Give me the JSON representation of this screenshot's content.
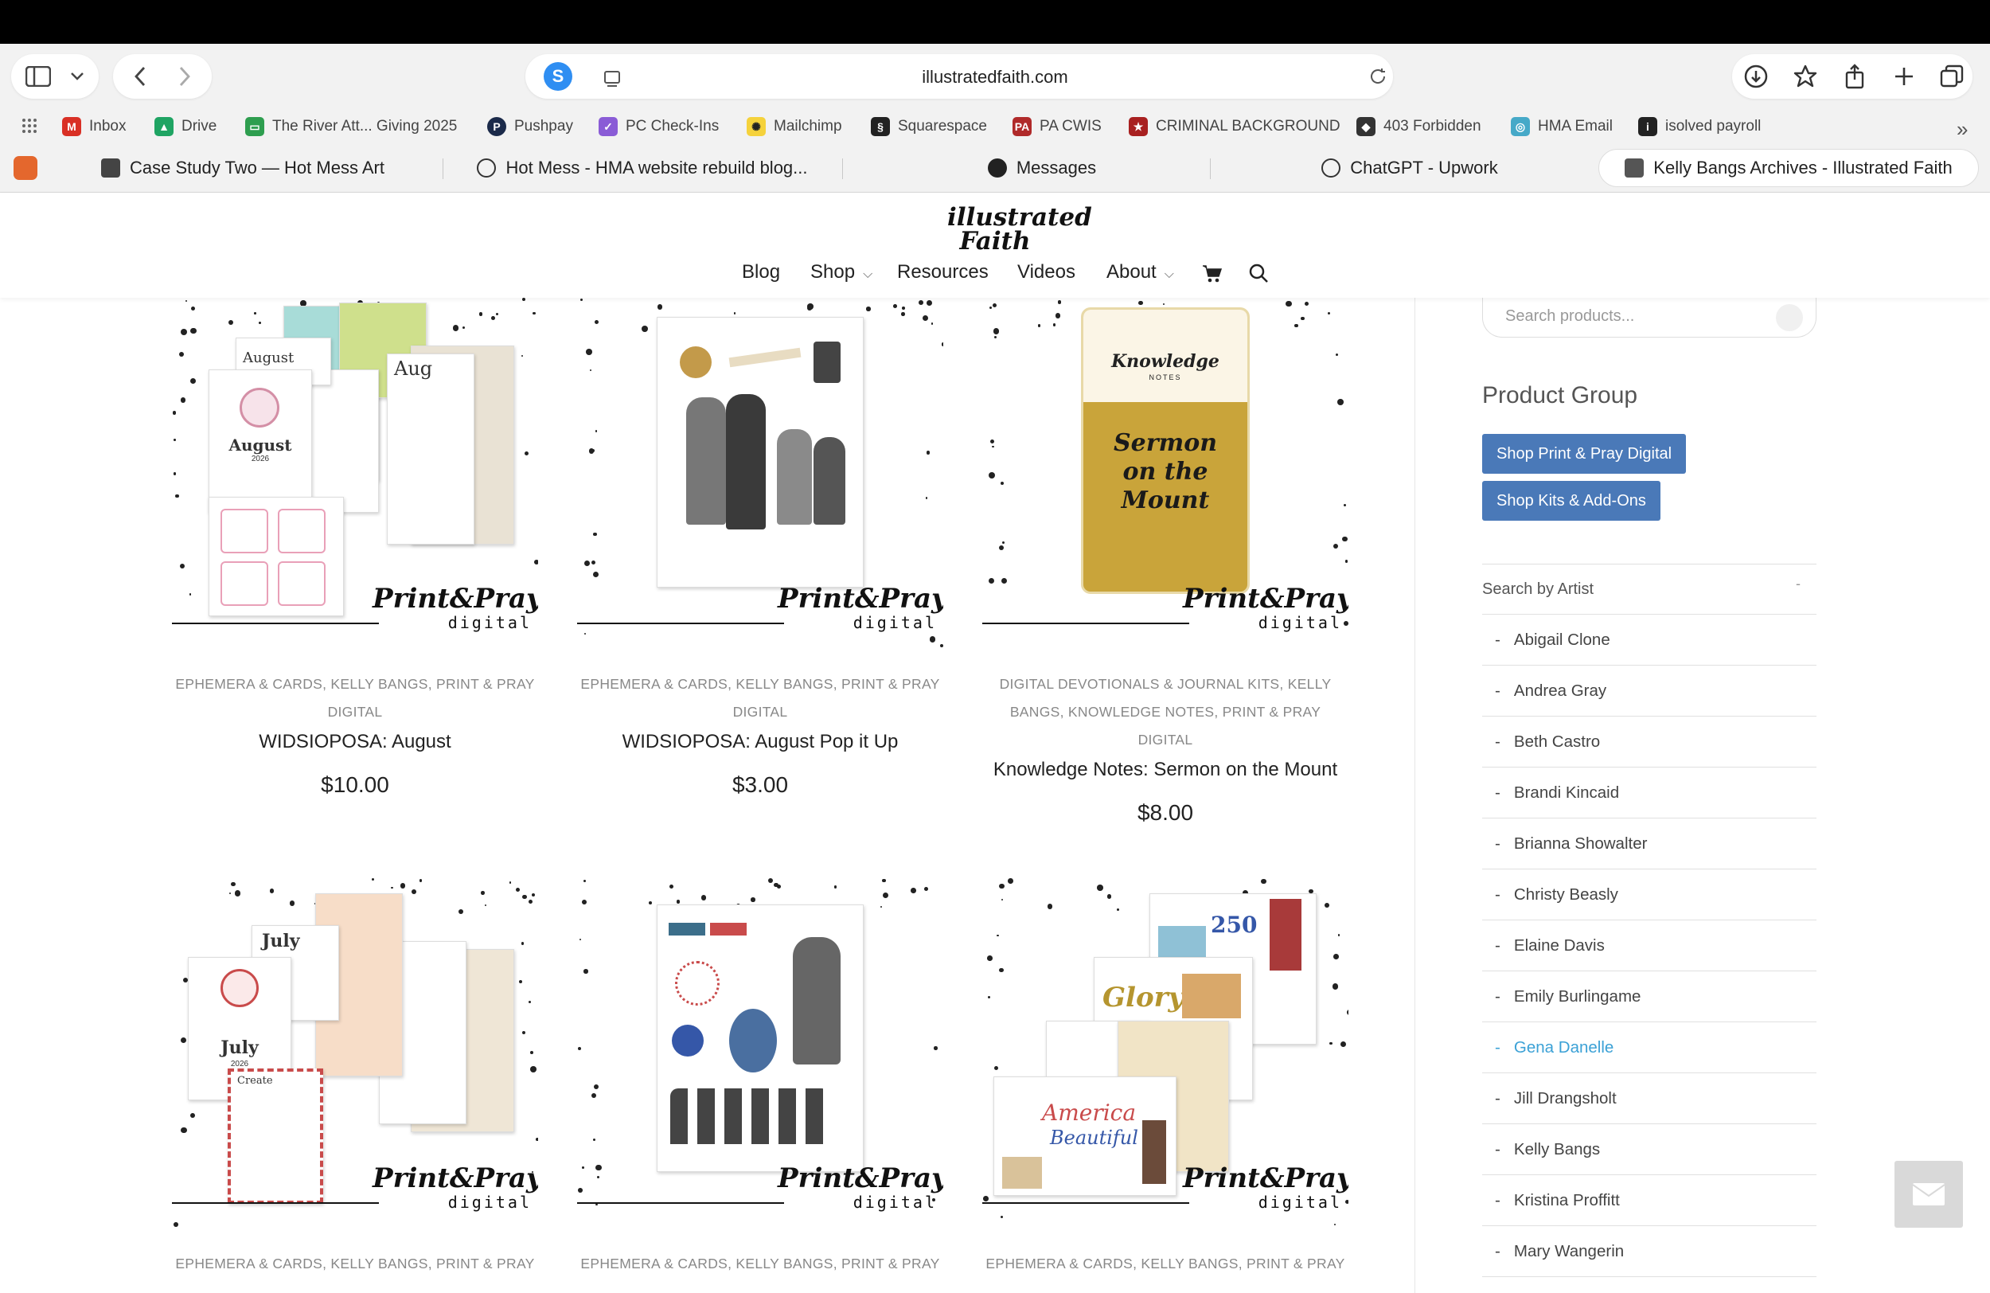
{
  "browser": {
    "url": "illustratedfaith.com",
    "bookmarks": [
      {
        "label": "Inbox",
        "icon": "gmail-icon",
        "color": "#d93025"
      },
      {
        "label": "Drive",
        "icon": "drive-icon",
        "color": "#1fa463"
      },
      {
        "label": "The River Att... Giving 2025",
        "icon": "giving-icon",
        "color": "#2e9e4f"
      },
      {
        "label": "Pushpay",
        "icon": "pushpay-icon",
        "color": "#1b2a4a"
      },
      {
        "label": "PC Check-Ins",
        "icon": "checkins-icon",
        "color": "#8a5cd6"
      },
      {
        "label": "Mailchimp",
        "icon": "mailchimp-icon",
        "color": "#f5d23c"
      },
      {
        "label": "Squarespace",
        "icon": "squarespace-icon",
        "color": "#222222"
      },
      {
        "label": "PA CWIS",
        "icon": "pa-icon",
        "color": "#b02a2a"
      },
      {
        "label": "CRIMINAL BACKGROUND",
        "icon": "badge-icon",
        "color": "#a82020"
      },
      {
        "label": "403 Forbidden",
        "icon": "cube-icon",
        "color": "#333333"
      },
      {
        "label": "HMA Email",
        "icon": "hma-icon",
        "color": "#46a9c8"
      },
      {
        "label": "isolved payroll",
        "icon": "isolved-icon",
        "color": "#222222"
      }
    ],
    "tabs": [
      {
        "label": "Case Study Two — Hot Mess Art",
        "icon": "cube-icon"
      },
      {
        "label": "Hot Mess - HMA website rebuild blog...",
        "icon": "openai-icon"
      },
      {
        "label": "Messages",
        "icon": "upwork-icon"
      },
      {
        "label": "ChatGPT - Upwork",
        "icon": "openai-icon"
      },
      {
        "label": "Kelly Bangs Archives - Illustrated Faith",
        "icon": "site-icon"
      }
    ]
  },
  "site": {
    "logo_text": "illustrated Faith",
    "nav": [
      {
        "label": "Blog"
      },
      {
        "label": "Shop"
      },
      {
        "label": "Resources"
      },
      {
        "label": "Videos"
      },
      {
        "label": "About"
      }
    ]
  },
  "products": [
    {
      "cats": [
        "EPHEMERA & CARDS, KELLY BANGS, PRINT & PRAY",
        "DIGITAL"
      ],
      "title": "WIDSIOPOSA: August",
      "price": "$10.00"
    },
    {
      "cats": [
        "EPHEMERA & CARDS, KELLY BANGS, PRINT & PRAY",
        "DIGITAL"
      ],
      "title": "WIDSIOPOSA: August Pop it Up",
      "price": "$3.00"
    },
    {
      "cats": [
        "DIGITAL DEVOTIONALS & JOURNAL KITS, KELLY",
        "BANGS, KNOWLEDGE NOTES, PRINT & PRAY DIGITAL"
      ],
      "title": "Knowledge Notes: Sermon on the Mount",
      "price": "$8.00"
    },
    {
      "cats": [
        "EPHEMERA & CARDS, KELLY BANGS, PRINT & PRAY"
      ]
    },
    {
      "cats": [
        "EPHEMERA & CARDS, KELLY BANGS, PRINT & PRAY"
      ]
    },
    {
      "cats": [
        "EPHEMERA & CARDS, KELLY BANGS, PRINT & PRAY"
      ]
    }
  ],
  "thumb_text": {
    "pp_big": "Print&Pray",
    "pp_digital": "digital",
    "august": "August",
    "aug": "Aug",
    "august_year": "2026",
    "july": "July",
    "july_year": "2026",
    "create": "Create",
    "kn_brand": "Knowledge",
    "kn_sub": "NOTES",
    "kn_title1": "Sermon",
    "kn_title2": "on the",
    "kn_title3": "Mount",
    "glory": "Glory",
    "america": "America",
    "beautiful": "Beautiful",
    "num250": "250"
  },
  "sidebar": {
    "search_placeholder": "Search products...",
    "group_title": "Product Group",
    "buttons": [
      "Shop Print & Pray Digital",
      "Shop Kits & Add-Ons"
    ],
    "artist_heading": "Search by Artist",
    "artists": [
      {
        "name": "Abigail Clone",
        "active": false
      },
      {
        "name": "Andrea Gray",
        "active": false
      },
      {
        "name": "Beth Castro",
        "active": false
      },
      {
        "name": "Brandi Kincaid",
        "active": false
      },
      {
        "name": "Brianna Showalter",
        "active": false
      },
      {
        "name": "Christy Beasly",
        "active": false
      },
      {
        "name": "Elaine Davis",
        "active": false
      },
      {
        "name": "Emily Burlingame",
        "active": false
      },
      {
        "name": "Gena Danelle",
        "active": true
      },
      {
        "name": "Jill Drangsholt",
        "active": false
      },
      {
        "name": "Kelly Bangs",
        "active": false
      },
      {
        "name": "Kristina Proffitt",
        "active": false
      },
      {
        "name": "Mary Wangerin",
        "active": false
      }
    ]
  },
  "colors": {
    "accent_blue": "#4a79b8",
    "active_link": "#3ba1d6",
    "mustard": "#c9a43a"
  }
}
